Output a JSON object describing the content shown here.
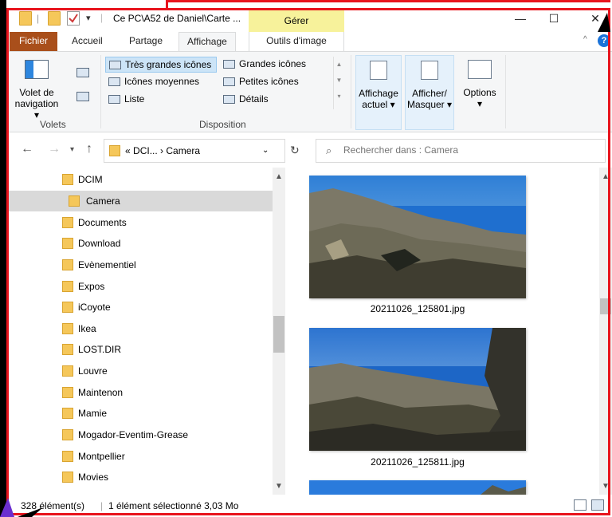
{
  "window": {
    "title": "Ce PC\\A52 de Daniel\\Carte ...",
    "manage_tab": "Gérer",
    "buttons": {
      "minimize": "—",
      "maximize": "☐",
      "close": "✕"
    }
  },
  "tabs": {
    "file": "Fichier",
    "home": "Accueil",
    "share": "Partage",
    "view": "Affichage",
    "image_tools": "Outils d'image"
  },
  "ribbon": {
    "panes": {
      "nav_pane_line1": "Volet de",
      "nav_pane_line2": "navigation",
      "group_label": "Volets"
    },
    "layout": {
      "xl_icons": "Très grandes icônes",
      "large_icons": "Grandes icônes",
      "medium_icons": "Icônes moyennes",
      "small_icons": "Petites icônes",
      "list": "Liste",
      "details": "Détails",
      "group_label": "Disposition"
    },
    "current_view_line1": "Affichage",
    "current_view_line2": "actuel",
    "show_hide_line1": "Afficher/",
    "show_hide_line2": "Masquer",
    "options": "Options"
  },
  "address": {
    "prefix": "«",
    "crumb1": "DCI...",
    "sep": "›",
    "crumb2": "Camera",
    "search_placeholder": "Rechercher dans : Camera"
  },
  "nav_items": [
    {
      "label": "DCIM"
    },
    {
      "label": "Camera"
    },
    {
      "label": "Documents"
    },
    {
      "label": "Download"
    },
    {
      "label": "Evènementiel"
    },
    {
      "label": "Expos"
    },
    {
      "label": "iCoyote"
    },
    {
      "label": "Ikea"
    },
    {
      "label": "LOST.DIR"
    },
    {
      "label": "Louvre"
    },
    {
      "label": "Maintenon"
    },
    {
      "label": "Mamie"
    },
    {
      "label": "Mogador-Eventim-Grease"
    },
    {
      "label": "Montpellier"
    },
    {
      "label": "Movies"
    }
  ],
  "files": [
    {
      "name": "20211026_125801.jpg"
    },
    {
      "name": "20211026_125811.jpg"
    }
  ],
  "status": {
    "count": "328 élément(s)",
    "selection": "1 élément sélectionné  3,03 Mo"
  },
  "colors": {
    "file_tab": "#a94f1b",
    "manage_tab": "#f7f29b",
    "annotation": "#e8141d",
    "folder": "#f5c75a"
  }
}
